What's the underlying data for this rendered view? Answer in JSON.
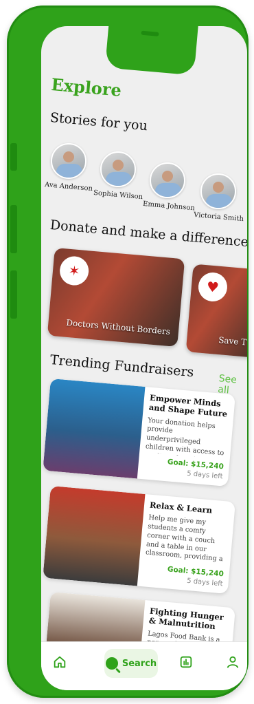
{
  "header": {
    "title": "Explore"
  },
  "stories": {
    "heading": "Stories for you",
    "items": [
      {
        "name": "Ava Anderson"
      },
      {
        "name": "Sophia Wilson"
      },
      {
        "name": "Emma Johnson"
      },
      {
        "name": "Victoria Smith"
      }
    ]
  },
  "donate": {
    "heading": "Donate and make a difference",
    "items": [
      {
        "name": "Doctors Without Borders",
        "logo_text": ""
      },
      {
        "name": "Save T",
        "logo_text": "Save the Children"
      }
    ]
  },
  "trending": {
    "heading": "Trending Fundraisers",
    "see_all": "See all",
    "items": [
      {
        "title": "Empower Minds and Shape Future",
        "desc": "Your donation helps provide underprivileged children with access to quality education...",
        "goal": "Goal: $15,240",
        "days": "5 days left"
      },
      {
        "title": "Relax & Learn",
        "desc": "Help me give my students a comfy corner with a couch and a table in our classroom, providing a relaxing...",
        "goal": "Goal: $15,240",
        "days": "5 days left"
      },
      {
        "title": "Fighting Hunger & Malnutrition",
        "desc": "Lagos Food Bank is a non-profit, nutrition-focused",
        "goal": "",
        "days": ""
      }
    ]
  },
  "nav": {
    "search_label": "Search"
  },
  "colors": {
    "accent": "#2fa21a",
    "frame": "#2fa21a",
    "screen_bg": "#efefef"
  },
  "icons": [
    "home-icon",
    "search-icon",
    "stats-icon",
    "profile-icon"
  ]
}
